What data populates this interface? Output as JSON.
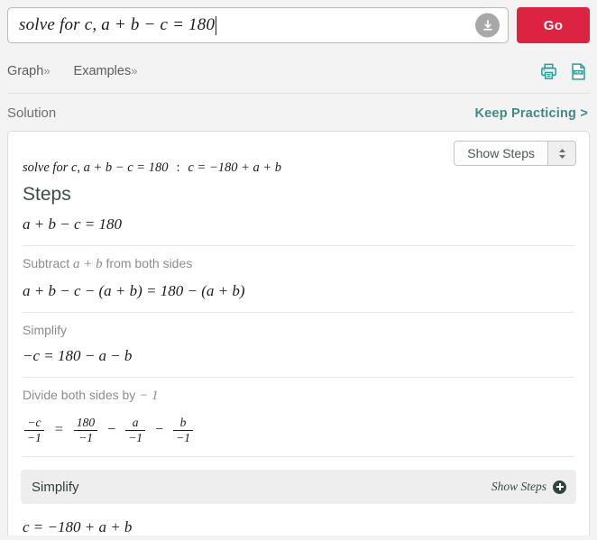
{
  "search": {
    "value": "solve for c, a + b − c = 180",
    "download_icon": "download-circle-icon",
    "go_label": "Go"
  },
  "nav": {
    "graph_label": "Graph",
    "examples_label": "Examples",
    "chevron": "»",
    "print_icon": "printer-icon",
    "pdf_icon": "pdf-icon",
    "pdf_badge": "PDF"
  },
  "solution_header": {
    "title": "Solution",
    "keep_practicing": "Keep Practicing >"
  },
  "card": {
    "show_steps_select": "Show Steps",
    "query_expression": "solve for c, a + b − c = 180",
    "query_separator": ":",
    "query_result": "c = −180 + a + b",
    "steps_title": "Steps",
    "initial_equation": "a + b − c = 180",
    "steps": [
      {
        "label_prefix": "Subtract",
        "label_math": "a + b",
        "label_suffix": "from both sides",
        "equation": "a + b − c − (a + b) = 180 − (a + b)"
      },
      {
        "label_prefix": "Simplify",
        "label_math": "",
        "label_suffix": "",
        "equation": "−c = 180 − a − b"
      }
    ],
    "divide_step": {
      "label_prefix": "Divide both sides by",
      "label_math": "− 1",
      "fraction_1_num": "−c",
      "fraction_1_den": "−1",
      "equals": "=",
      "fraction_2_num": "180",
      "fraction_2_den": "−1",
      "op_1": "−",
      "fraction_3_num": "a",
      "fraction_3_den": "−1",
      "op_2": "−",
      "fraction_4_num": "b",
      "fraction_4_den": "−1"
    },
    "final_simplify": {
      "label": "Simplify",
      "show_steps": "Show Steps",
      "plus_icon": "plus-circle-icon",
      "equation": "c = −180 + a + b"
    }
  },
  "colors": {
    "accent_red": "#dc2442",
    "accent_teal": "#3f8a85",
    "page_bg": "#f4f3f4",
    "heading": "#3c4d4b"
  }
}
